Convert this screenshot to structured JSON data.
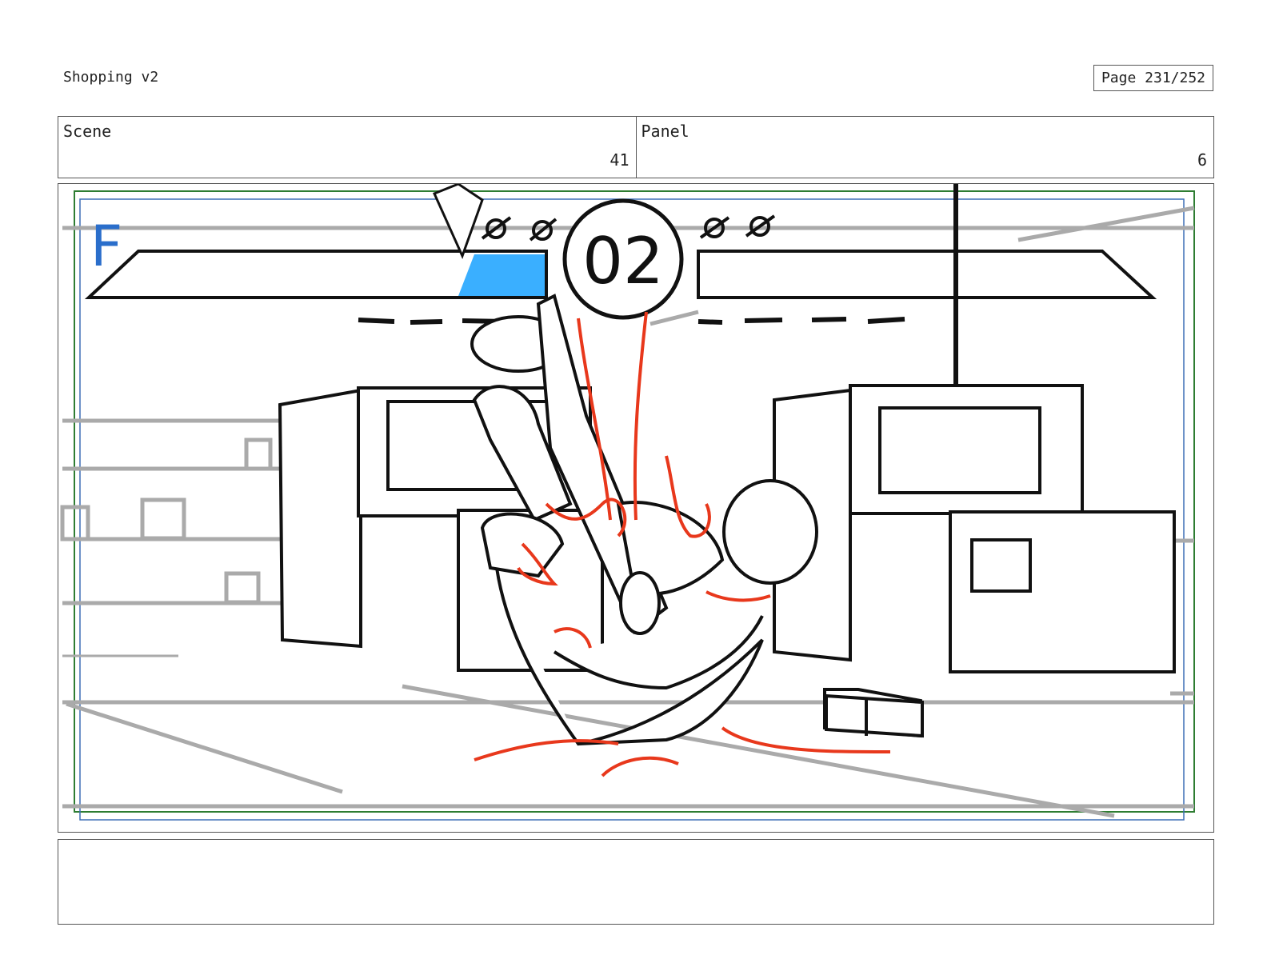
{
  "header": {
    "title": "Shopping v2",
    "page": "Page 231/252"
  },
  "scene": {
    "label": "Scene",
    "value": "41"
  },
  "panel": {
    "label": "Panel",
    "value": "6"
  },
  "sketch": {
    "frame_marker": "F",
    "timer": "02",
    "colors": {
      "ink": "#111111",
      "red": "#e8381c",
      "blue": "#3aafff",
      "grey": "#aaaaaa",
      "marker_blue": "#2a6ecb",
      "safe_green": "#2e7d32"
    }
  },
  "notes": {
    "text": ""
  }
}
